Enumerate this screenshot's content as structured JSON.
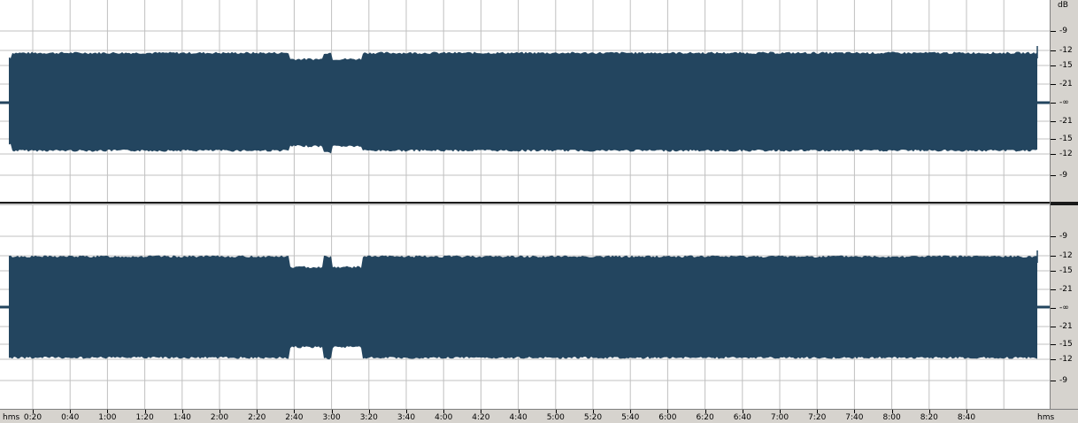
{
  "waveform": {
    "color": "#23455f",
    "background": "#ffffff",
    "grid_color": "#c0c0c0",
    "channels": [
      "channel-1",
      "channel-2"
    ]
  },
  "db_ruler": {
    "unit": "dB",
    "labels_top": [
      "-9",
      "-12",
      "-15",
      "-21",
      "-∞",
      "-21",
      "-15",
      "-12",
      "-9"
    ],
    "labels_bottom": [
      "-9",
      "-12",
      "-15",
      "-21",
      "-∞",
      "-21",
      "-15",
      "-12",
      "-9"
    ]
  },
  "time_ruler": {
    "unit_left": "hms",
    "unit_right": "hms",
    "labels": [
      "0:20",
      "0:40",
      "1:00",
      "1:20",
      "1:40",
      "2:00",
      "2:20",
      "2:40",
      "3:00",
      "3:20",
      "3:40",
      "4:00",
      "4:20",
      "4:40",
      "5:00",
      "5:20",
      "5:40",
      "6:00",
      "6:20",
      "6:40",
      "7:00",
      "7:20",
      "7:40",
      "8:00",
      "8:20",
      "8:40"
    ]
  }
}
